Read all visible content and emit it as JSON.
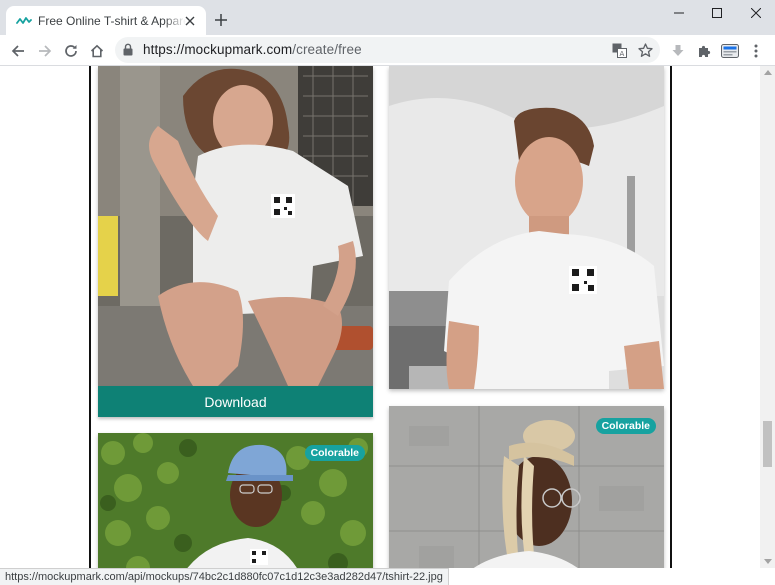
{
  "browser": {
    "tab": {
      "title": "Free Online T-shirt & Apparel M",
      "favicon": "mockupmark-wave-icon"
    },
    "new_tab_label": "+",
    "window_controls": [
      "minimize",
      "maximize",
      "close"
    ],
    "url_host": "https://mockupmark.com",
    "url_path": "/create/free",
    "toolbar_icons": [
      "back-icon",
      "forward-icon",
      "reload-icon",
      "home-icon",
      "lock-icon",
      "translate-icon",
      "bookmark-star-icon",
      "download-icon",
      "extensions-icon",
      "profile-icon",
      "menu-icon"
    ]
  },
  "mockups": {
    "download_label": "Download",
    "colorable_badge": "Colorable"
  },
  "status_bar": {
    "text": "https://mockupmark.com/api/mockups/74bc2c1d880fc07c1d12c3e3ad282d47/tshirt-22.jpg"
  },
  "colors": {
    "accent": "#0e8175",
    "badge": "#17a2a0",
    "chrome": "#dee1e6"
  }
}
